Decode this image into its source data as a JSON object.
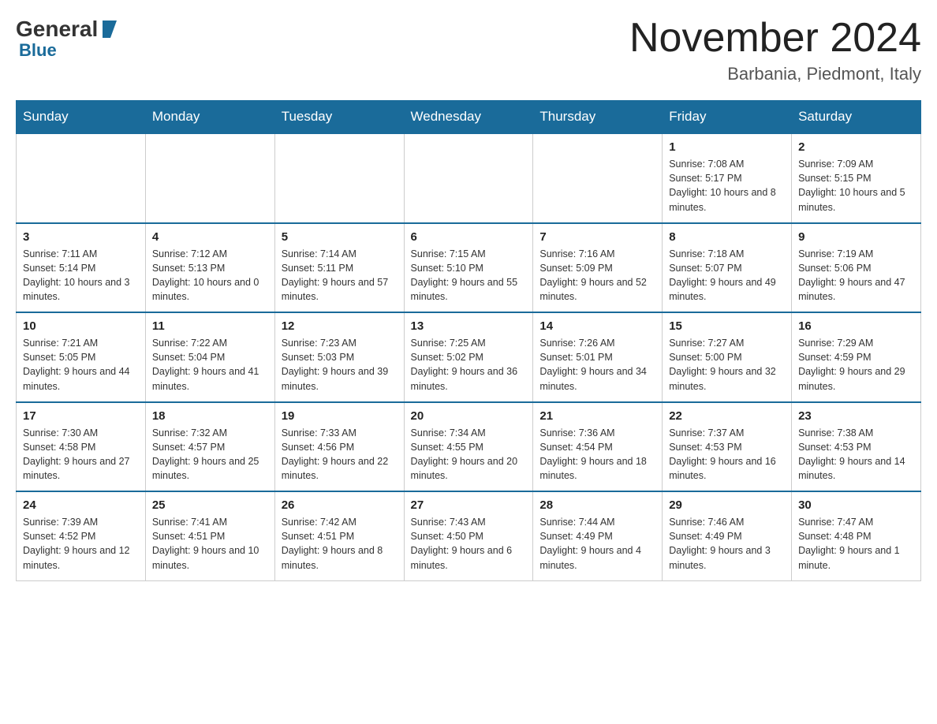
{
  "logo": {
    "general": "General",
    "blue": "Blue"
  },
  "title": {
    "month": "November 2024",
    "location": "Barbania, Piedmont, Italy"
  },
  "headers": [
    "Sunday",
    "Monday",
    "Tuesday",
    "Wednesday",
    "Thursday",
    "Friday",
    "Saturday"
  ],
  "weeks": [
    [
      {
        "day": "",
        "info": ""
      },
      {
        "day": "",
        "info": ""
      },
      {
        "day": "",
        "info": ""
      },
      {
        "day": "",
        "info": ""
      },
      {
        "day": "",
        "info": ""
      },
      {
        "day": "1",
        "info": "Sunrise: 7:08 AM\nSunset: 5:17 PM\nDaylight: 10 hours and 8 minutes."
      },
      {
        "day": "2",
        "info": "Sunrise: 7:09 AM\nSunset: 5:15 PM\nDaylight: 10 hours and 5 minutes."
      }
    ],
    [
      {
        "day": "3",
        "info": "Sunrise: 7:11 AM\nSunset: 5:14 PM\nDaylight: 10 hours and 3 minutes."
      },
      {
        "day": "4",
        "info": "Sunrise: 7:12 AM\nSunset: 5:13 PM\nDaylight: 10 hours and 0 minutes."
      },
      {
        "day": "5",
        "info": "Sunrise: 7:14 AM\nSunset: 5:11 PM\nDaylight: 9 hours and 57 minutes."
      },
      {
        "day": "6",
        "info": "Sunrise: 7:15 AM\nSunset: 5:10 PM\nDaylight: 9 hours and 55 minutes."
      },
      {
        "day": "7",
        "info": "Sunrise: 7:16 AM\nSunset: 5:09 PM\nDaylight: 9 hours and 52 minutes."
      },
      {
        "day": "8",
        "info": "Sunrise: 7:18 AM\nSunset: 5:07 PM\nDaylight: 9 hours and 49 minutes."
      },
      {
        "day": "9",
        "info": "Sunrise: 7:19 AM\nSunset: 5:06 PM\nDaylight: 9 hours and 47 minutes."
      }
    ],
    [
      {
        "day": "10",
        "info": "Sunrise: 7:21 AM\nSunset: 5:05 PM\nDaylight: 9 hours and 44 minutes."
      },
      {
        "day": "11",
        "info": "Sunrise: 7:22 AM\nSunset: 5:04 PM\nDaylight: 9 hours and 41 minutes."
      },
      {
        "day": "12",
        "info": "Sunrise: 7:23 AM\nSunset: 5:03 PM\nDaylight: 9 hours and 39 minutes."
      },
      {
        "day": "13",
        "info": "Sunrise: 7:25 AM\nSunset: 5:02 PM\nDaylight: 9 hours and 36 minutes."
      },
      {
        "day": "14",
        "info": "Sunrise: 7:26 AM\nSunset: 5:01 PM\nDaylight: 9 hours and 34 minutes."
      },
      {
        "day": "15",
        "info": "Sunrise: 7:27 AM\nSunset: 5:00 PM\nDaylight: 9 hours and 32 minutes."
      },
      {
        "day": "16",
        "info": "Sunrise: 7:29 AM\nSunset: 4:59 PM\nDaylight: 9 hours and 29 minutes."
      }
    ],
    [
      {
        "day": "17",
        "info": "Sunrise: 7:30 AM\nSunset: 4:58 PM\nDaylight: 9 hours and 27 minutes."
      },
      {
        "day": "18",
        "info": "Sunrise: 7:32 AM\nSunset: 4:57 PM\nDaylight: 9 hours and 25 minutes."
      },
      {
        "day": "19",
        "info": "Sunrise: 7:33 AM\nSunset: 4:56 PM\nDaylight: 9 hours and 22 minutes."
      },
      {
        "day": "20",
        "info": "Sunrise: 7:34 AM\nSunset: 4:55 PM\nDaylight: 9 hours and 20 minutes."
      },
      {
        "day": "21",
        "info": "Sunrise: 7:36 AM\nSunset: 4:54 PM\nDaylight: 9 hours and 18 minutes."
      },
      {
        "day": "22",
        "info": "Sunrise: 7:37 AM\nSunset: 4:53 PM\nDaylight: 9 hours and 16 minutes."
      },
      {
        "day": "23",
        "info": "Sunrise: 7:38 AM\nSunset: 4:53 PM\nDaylight: 9 hours and 14 minutes."
      }
    ],
    [
      {
        "day": "24",
        "info": "Sunrise: 7:39 AM\nSunset: 4:52 PM\nDaylight: 9 hours and 12 minutes."
      },
      {
        "day": "25",
        "info": "Sunrise: 7:41 AM\nSunset: 4:51 PM\nDaylight: 9 hours and 10 minutes."
      },
      {
        "day": "26",
        "info": "Sunrise: 7:42 AM\nSunset: 4:51 PM\nDaylight: 9 hours and 8 minutes."
      },
      {
        "day": "27",
        "info": "Sunrise: 7:43 AM\nSunset: 4:50 PM\nDaylight: 9 hours and 6 minutes."
      },
      {
        "day": "28",
        "info": "Sunrise: 7:44 AM\nSunset: 4:49 PM\nDaylight: 9 hours and 4 minutes."
      },
      {
        "day": "29",
        "info": "Sunrise: 7:46 AM\nSunset: 4:49 PM\nDaylight: 9 hours and 3 minutes."
      },
      {
        "day": "30",
        "info": "Sunrise: 7:47 AM\nSunset: 4:48 PM\nDaylight: 9 hours and 1 minute."
      }
    ]
  ]
}
